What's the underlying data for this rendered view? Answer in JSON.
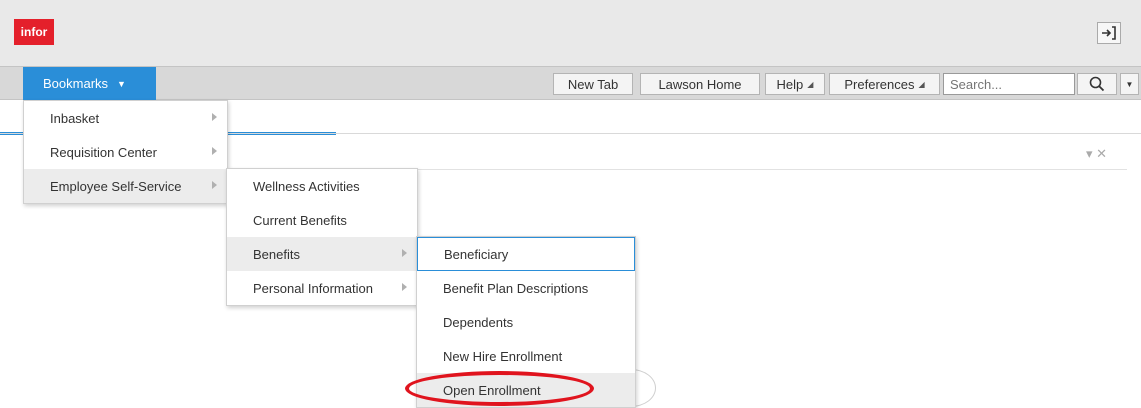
{
  "header": {
    "logo": "infor",
    "signout_icon": "sign-in-arrow-icon"
  },
  "toolbar": {
    "bookmarks_label": "Bookmarks",
    "new_tab": "New Tab",
    "lawson_home": "Lawson Home",
    "help": "Help",
    "preferences": "Preferences",
    "search_placeholder": "Search...",
    "search_icon": "magnifier-icon"
  },
  "panel": {
    "controls": "▾  ✕"
  },
  "menus": {
    "level1": [
      "Inbasket",
      "Requisition Center",
      "Employee Self-Service"
    ],
    "level2": [
      "Wellness Activities",
      "Current Benefits",
      "Benefits",
      "Personal Information"
    ],
    "level3": [
      "Beneficiary",
      "Benefit Plan Descriptions",
      "Dependents",
      "New Hire Enrollment",
      "Open Enrollment"
    ]
  },
  "colors": {
    "accent": "#2a8ed8",
    "logo_red": "#e4202b",
    "annotation_red": "#e0141e"
  }
}
